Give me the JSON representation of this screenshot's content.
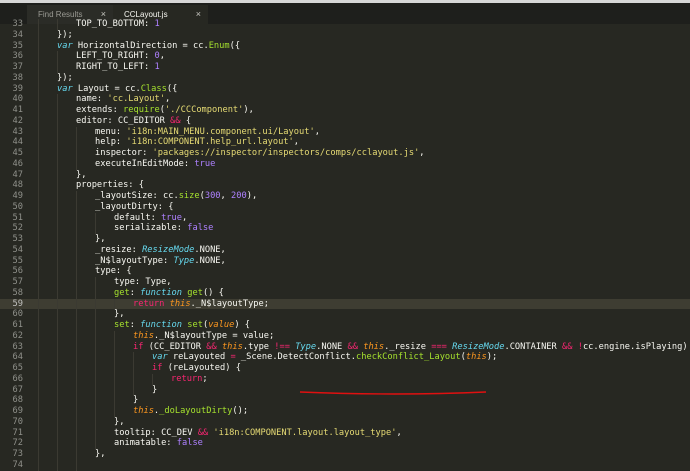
{
  "tabs": [
    {
      "label": "Find Results",
      "close_glyph": "×",
      "active": false
    },
    {
      "label": "CCLayout.js",
      "close_glyph": "×",
      "active": true
    }
  ],
  "code": {
    "highlighted_line": 59,
    "colors": {
      "background": "#272822",
      "keyword": "#f92672",
      "string": "#e6db74",
      "number": "#ae81ff",
      "type": "#66d9ef",
      "function": "#a6e22e",
      "annotation_underline": "#e01010"
    },
    "lines": [
      {
        "n": 33,
        "indent": 2,
        "tokens": [
          {
            "t": "TOP_TO_BOTTOM: ",
            "c": "tx"
          },
          {
            "t": "1",
            "c": "nm"
          }
        ]
      },
      {
        "n": 34,
        "indent": 1,
        "tokens": [
          {
            "t": "});",
            "c": "tx"
          }
        ]
      },
      {
        "n": 35,
        "indent": 1,
        "tokens": [
          {
            "t": "var ",
            "c": "ty"
          },
          {
            "t": "HorizontalDirection = cc.",
            "c": "tx"
          },
          {
            "t": "Enum",
            "c": "fn"
          },
          {
            "t": "({",
            "c": "tx"
          }
        ]
      },
      {
        "n": 36,
        "indent": 2,
        "tokens": [
          {
            "t": "LEFT_TO_RIGHT: ",
            "c": "tx"
          },
          {
            "t": "0",
            "c": "nm"
          },
          {
            "t": ",",
            "c": "tx"
          }
        ]
      },
      {
        "n": 37,
        "indent": 2,
        "tokens": [
          {
            "t": "RIGHT_TO_LEFT: ",
            "c": "tx"
          },
          {
            "t": "1",
            "c": "nm"
          }
        ]
      },
      {
        "n": 38,
        "indent": 1,
        "tokens": [
          {
            "t": "});",
            "c": "tx"
          }
        ]
      },
      {
        "n": 39,
        "indent": 1,
        "tokens": [
          {
            "t": "var ",
            "c": "ty"
          },
          {
            "t": "Layout = cc.",
            "c": "tx"
          },
          {
            "t": "Class",
            "c": "fn"
          },
          {
            "t": "({",
            "c": "tx"
          }
        ]
      },
      {
        "n": 40,
        "indent": 2,
        "tokens": [
          {
            "t": "name: ",
            "c": "tx"
          },
          {
            "t": "'cc.Layout'",
            "c": "st"
          },
          {
            "t": ",",
            "c": "tx"
          }
        ]
      },
      {
        "n": 41,
        "indent": 2,
        "tokens": [
          {
            "t": "extends: ",
            "c": "tx"
          },
          {
            "t": "require",
            "c": "fn"
          },
          {
            "t": "(",
            "c": "tx"
          },
          {
            "t": "'./CCComponent'",
            "c": "st"
          },
          {
            "t": "),",
            "c": "tx"
          }
        ]
      },
      {
        "n": 42,
        "indent": 2,
        "tokens": [
          {
            "t": "editor: CC_EDITOR ",
            "c": "tx"
          },
          {
            "t": "&&",
            "c": "kw"
          },
          {
            "t": " {",
            "c": "tx"
          }
        ]
      },
      {
        "n": 43,
        "indent": 3,
        "tokens": [
          {
            "t": "menu: ",
            "c": "tx"
          },
          {
            "t": "'i18n:MAIN_MENU.component.ui/Layout'",
            "c": "st"
          },
          {
            "t": ",",
            "c": "tx"
          }
        ]
      },
      {
        "n": 44,
        "indent": 3,
        "tokens": [
          {
            "t": "help: ",
            "c": "tx"
          },
          {
            "t": "'i18n:COMPONENT.help_url.layout'",
            "c": "st"
          },
          {
            "t": ",",
            "c": "tx"
          }
        ]
      },
      {
        "n": 45,
        "indent": 3,
        "tokens": [
          {
            "t": "inspector: ",
            "c": "tx"
          },
          {
            "t": "'packages://inspector/inspectors/comps/cclayout.js'",
            "c": "st"
          },
          {
            "t": ",",
            "c": "tx"
          }
        ]
      },
      {
        "n": 46,
        "indent": 3,
        "tokens": [
          {
            "t": "executeInEditMode: ",
            "c": "tx"
          },
          {
            "t": "true",
            "c": "nm"
          }
        ]
      },
      {
        "n": 47,
        "indent": 2,
        "tokens": [
          {
            "t": "},",
            "c": "tx"
          }
        ]
      },
      {
        "n": 48,
        "indent": 2,
        "tokens": [
          {
            "t": "properties: {",
            "c": "tx"
          }
        ]
      },
      {
        "n": 49,
        "indent": 3,
        "tokens": [
          {
            "t": "_layoutSize: cc.",
            "c": "tx"
          },
          {
            "t": "size",
            "c": "fn"
          },
          {
            "t": "(",
            "c": "tx"
          },
          {
            "t": "300",
            "c": "nm"
          },
          {
            "t": ", ",
            "c": "tx"
          },
          {
            "t": "200",
            "c": "nm"
          },
          {
            "t": "),",
            "c": "tx"
          }
        ]
      },
      {
        "n": 50,
        "indent": 3,
        "tokens": [
          {
            "t": "_layoutDirty: {",
            "c": "tx"
          }
        ]
      },
      {
        "n": 51,
        "indent": 4,
        "tokens": [
          {
            "t": "default: ",
            "c": "tx"
          },
          {
            "t": "true",
            "c": "nm"
          },
          {
            "t": ",",
            "c": "tx"
          }
        ]
      },
      {
        "n": 52,
        "indent": 4,
        "tokens": [
          {
            "t": "serializable: ",
            "c": "tx"
          },
          {
            "t": "false",
            "c": "nm"
          }
        ]
      },
      {
        "n": 53,
        "indent": 3,
        "tokens": [
          {
            "t": "},",
            "c": "tx"
          }
        ]
      },
      {
        "n": 54,
        "indent": 3,
        "tokens": [
          {
            "t": "_resize: ",
            "c": "tx"
          },
          {
            "t": "ResizeMode",
            "c": "ty"
          },
          {
            "t": ".NONE,",
            "c": "tx"
          }
        ]
      },
      {
        "n": 55,
        "indent": 3,
        "tokens": [
          {
            "t": "_N$layoutType: ",
            "c": "tx"
          },
          {
            "t": "Type",
            "c": "ty"
          },
          {
            "t": ".NONE,",
            "c": "tx"
          }
        ]
      },
      {
        "n": 56,
        "indent": 3,
        "tokens": [
          {
            "t": "type: {",
            "c": "tx"
          }
        ]
      },
      {
        "n": 57,
        "indent": 4,
        "tokens": [
          {
            "t": "type: Type,",
            "c": "tx"
          }
        ]
      },
      {
        "n": 58,
        "indent": 4,
        "tokens": [
          {
            "t": "get",
            "c": "fn"
          },
          {
            "t": ": ",
            "c": "tx"
          },
          {
            "t": "function ",
            "c": "ty"
          },
          {
            "t": "get",
            "c": "fn"
          },
          {
            "t": "() {",
            "c": "tx"
          }
        ]
      },
      {
        "n": 59,
        "indent": 5,
        "tokens": [
          {
            "t": "return ",
            "c": "kw"
          },
          {
            "t": "this",
            "c": "it"
          },
          {
            "t": "._N$layoutType;",
            "c": "tx"
          }
        ]
      },
      {
        "n": 60,
        "indent": 4,
        "tokens": [
          {
            "t": "},",
            "c": "tx"
          }
        ]
      },
      {
        "n": 61,
        "indent": 4,
        "tokens": [
          {
            "t": "set",
            "c": "fn"
          },
          {
            "t": ": ",
            "c": "tx"
          },
          {
            "t": "function ",
            "c": "ty"
          },
          {
            "t": "set",
            "c": "fn"
          },
          {
            "t": "(",
            "c": "tx"
          },
          {
            "t": "value",
            "c": "it"
          },
          {
            "t": ") {",
            "c": "tx"
          }
        ]
      },
      {
        "n": 62,
        "indent": 5,
        "tokens": [
          {
            "t": "this",
            "c": "it"
          },
          {
            "t": "._N$layoutType = value;",
            "c": "tx"
          }
        ]
      },
      {
        "n": 63,
        "indent": 5,
        "tokens": [
          {
            "t": "if ",
            "c": "kw"
          },
          {
            "t": "(CC_EDITOR ",
            "c": "tx"
          },
          {
            "t": "&&",
            "c": "kw"
          },
          {
            "t": " ",
            "c": "tx"
          },
          {
            "t": "this",
            "c": "it"
          },
          {
            "t": ".type ",
            "c": "tx"
          },
          {
            "t": "!==",
            "c": "kw"
          },
          {
            "t": " ",
            "c": "tx"
          },
          {
            "t": "Type",
            "c": "ty"
          },
          {
            "t": ".NONE ",
            "c": "tx"
          },
          {
            "t": "&&",
            "c": "kw"
          },
          {
            "t": " ",
            "c": "tx"
          },
          {
            "t": "this",
            "c": "it"
          },
          {
            "t": "._resize ",
            "c": "tx"
          },
          {
            "t": "===",
            "c": "kw"
          },
          {
            "t": " ",
            "c": "tx"
          },
          {
            "t": "ResizeMode",
            "c": "ty"
          },
          {
            "t": ".CONTAINER ",
            "c": "tx"
          },
          {
            "t": "&&",
            "c": "kw"
          },
          {
            "t": " ",
            "c": "tx"
          },
          {
            "t": "!",
            "c": "kw"
          },
          {
            "t": "cc.engine.isPlaying) {",
            "c": "tx"
          }
        ]
      },
      {
        "n": 64,
        "indent": 6,
        "tokens": [
          {
            "t": "var ",
            "c": "ty"
          },
          {
            "t": "reLayouted ",
            "c": "tx"
          },
          {
            "t": "=",
            "c": "kw"
          },
          {
            "t": " _Scene.DetectConflict.",
            "c": "tx"
          },
          {
            "t": "checkConflict_Layout",
            "c": "fn"
          },
          {
            "t": "(",
            "c": "tx"
          },
          {
            "t": "this",
            "c": "it"
          },
          {
            "t": ");",
            "c": "tx"
          }
        ]
      },
      {
        "n": 65,
        "indent": 6,
        "tokens": [
          {
            "t": "if ",
            "c": "kw"
          },
          {
            "t": "(reLayouted) {",
            "c": "tx"
          }
        ]
      },
      {
        "n": 66,
        "indent": 7,
        "tokens": [
          {
            "t": "return",
            "c": "kw"
          },
          {
            "t": ";",
            "c": "tx"
          }
        ]
      },
      {
        "n": 67,
        "indent": 6,
        "tokens": [
          {
            "t": "}",
            "c": "tx"
          }
        ]
      },
      {
        "n": 68,
        "indent": 5,
        "tokens": [
          {
            "t": "}",
            "c": "tx"
          }
        ]
      },
      {
        "n": 69,
        "indent": 5,
        "tokens": [
          {
            "t": "this",
            "c": "it"
          },
          {
            "t": ".",
            "c": "tx"
          },
          {
            "t": "_doLayoutDirty",
            "c": "fn"
          },
          {
            "t": "();",
            "c": "tx"
          }
        ]
      },
      {
        "n": 70,
        "indent": 4,
        "tokens": [
          {
            "t": "},",
            "c": "tx"
          }
        ]
      },
      {
        "n": 71,
        "indent": 4,
        "tokens": [
          {
            "t": "tooltip: CC_DEV ",
            "c": "tx"
          },
          {
            "t": "&&",
            "c": "kw"
          },
          {
            "t": " ",
            "c": "tx"
          },
          {
            "t": "'i18n:COMPONENT.layout.layout_type'",
            "c": "st"
          },
          {
            "t": ",",
            "c": "tx"
          }
        ]
      },
      {
        "n": 72,
        "indent": 4,
        "tokens": [
          {
            "t": "animatable: ",
            "c": "tx"
          },
          {
            "t": "false",
            "c": "nm"
          }
        ]
      },
      {
        "n": 73,
        "indent": 3,
        "tokens": [
          {
            "t": "},",
            "c": "tx"
          }
        ]
      },
      {
        "n": 74,
        "indent": 3,
        "tokens": [
          {
            "t": "",
            "c": "tx"
          }
        ]
      }
    ]
  }
}
